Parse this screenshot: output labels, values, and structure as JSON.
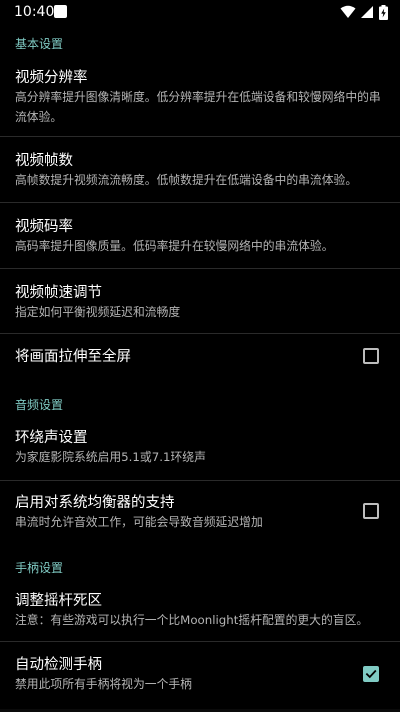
{
  "status_bar": {
    "time": "10:40",
    "icons": [
      "app-notification-icon",
      "wifi-icon",
      "cellular-signal-icon",
      "battery-charging-icon"
    ]
  },
  "colors": {
    "background": "#000000",
    "accent": "#80cbc4",
    "title_text": "#ffffff",
    "summary_text": "#b4b4b4",
    "divider": "#2a2a2a"
  },
  "sections": {
    "basic": {
      "header": "基本设置",
      "items": [
        {
          "title": "视频分辨率",
          "summary": "高分辨率提升图像清晰度。低分辨率提升在低端设备和较慢网络中的串流体验。"
        },
        {
          "title": "视频帧数",
          "summary": "高帧数提升视频流流畅度。低帧数提升在低端设备中的串流体验。"
        },
        {
          "title": "视频码率",
          "summary": "高码率提升图像质量。低码率提升在较慢网络中的串流体验。"
        },
        {
          "title": "视频帧速调节",
          "summary": "指定如何平衡视频延迟和流畅度"
        },
        {
          "title": "将画面拉伸至全屏",
          "checked": false
        }
      ]
    },
    "audio": {
      "header": "音频设置",
      "items": [
        {
          "title": "环绕声设置",
          "summary": "为家庭影院系统启用5.1或7.1环绕声"
        },
        {
          "title": "启用对系统均衡器的支持",
          "summary": "串流时允许音效工作，可能会导致音频延迟增加",
          "checked": false
        }
      ]
    },
    "gamepad": {
      "header": "手柄设置",
      "items": [
        {
          "title": "调整摇杆死区",
          "summary": "注意：有些游戏可以执行一个比Moonlight摇杆配置的更大的盲区。"
        },
        {
          "title": "自动检测手柄",
          "summary": "禁用此项所有手柄将视为一个手柄",
          "checked": true
        }
      ]
    }
  }
}
